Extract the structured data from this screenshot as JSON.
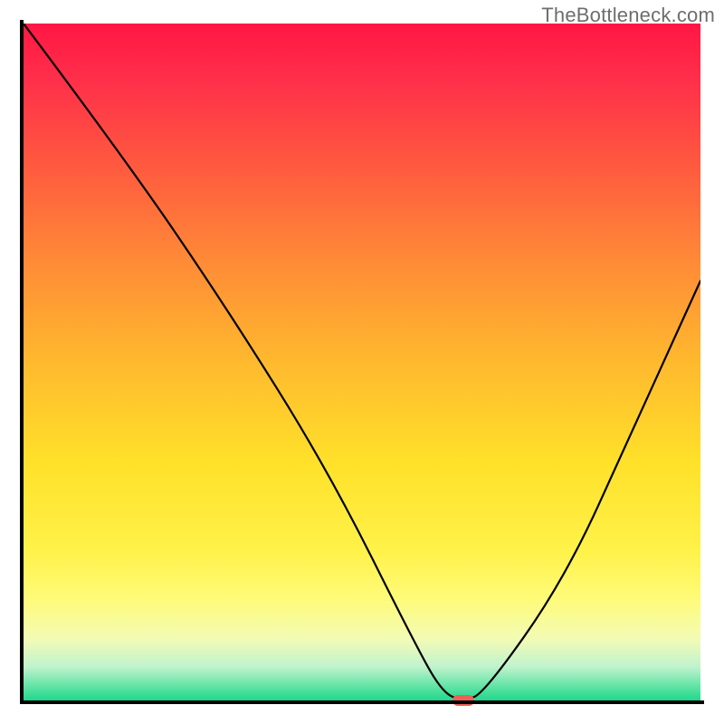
{
  "watermark": "TheBottleneck.com",
  "chart_data": {
    "type": "line",
    "title": "",
    "xlabel": "",
    "ylabel": "",
    "xlim": [
      0,
      100
    ],
    "ylim": [
      0,
      100
    ],
    "x": [
      0,
      15,
      30,
      45,
      58,
      62,
      65,
      68,
      80,
      90,
      100
    ],
    "values": [
      100,
      80,
      58,
      34,
      8,
      1,
      0,
      1,
      18,
      40,
      62
    ],
    "marker_x": 65,
    "marker_y": 0
  }
}
